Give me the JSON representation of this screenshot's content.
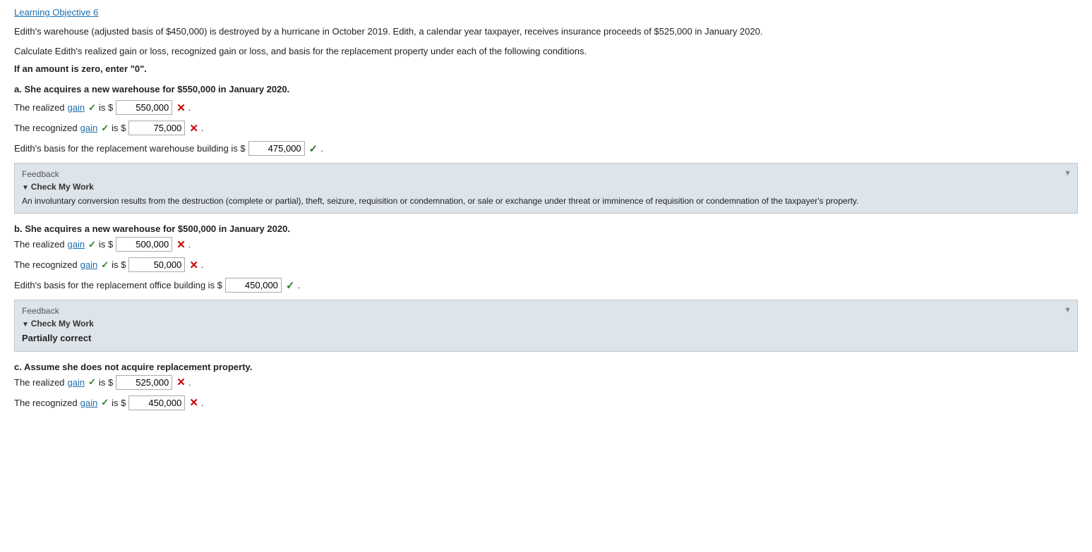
{
  "learningObj": {
    "label": "Learning Objective 6"
  },
  "introText": "Edith's warehouse (adjusted basis of $450,000) is destroyed by a hurricane in October 2019. Edith, a calendar year taxpayer, receives insurance proceeds of $525,000 in January 2020.",
  "calcText": "Calculate Edith's realized gain or loss, recognized gain or loss, and basis for the replacement property under each of the following conditions.",
  "zeroNote": "If an amount is zero, enter \"0\".",
  "sectionA": {
    "label": "a.",
    "description": "She acquires a new warehouse for $550,000 in January 2020.",
    "realizedRow": {
      "prefix": "The realized",
      "gainLabel": "gain",
      "checkmark": "✓",
      "isText": "is $",
      "value": "550,000",
      "xMark": "✕",
      "period": "."
    },
    "recognizedRow": {
      "prefix": "The recognized",
      "gainLabel": "gain",
      "checkmark": "✓",
      "isText": "is $",
      "value": "75,000",
      "xMark": "✕",
      "period": "."
    },
    "basisRow": {
      "prefix": "Edith's basis for the replacement warehouse building is $",
      "value": "475,000",
      "checkmark": "✓",
      "period": "."
    },
    "feedback": {
      "header": "Feedback",
      "checkMyWork": "Check My Work",
      "content": "An involuntary conversion results from the destruction (complete or partial), theft, seizure, requisition or condemnation, or sale or exchange under threat or imminence of requisition or condemnation of the taxpayer's property."
    }
  },
  "sectionB": {
    "label": "b.",
    "description": "She acquires a new warehouse for $500,000 in January 2020.",
    "realizedRow": {
      "prefix": "The realized",
      "gainLabel": "gain",
      "checkmark": "✓",
      "isText": "is $",
      "value": "500,000",
      "xMark": "✕",
      "period": "."
    },
    "recognizedRow": {
      "prefix": "The recognized",
      "gainLabel": "gain",
      "checkmark": "✓",
      "isText": "is $",
      "value": "50,000",
      "xMark": "✕",
      "period": "."
    },
    "basisRow": {
      "prefix": "Edith's basis for the replacement office building is $",
      "value": "450,000",
      "checkmark": "✓",
      "period": "."
    },
    "feedback": {
      "header": "Feedback",
      "checkMyWork": "Check My Work",
      "content": "Partially correct"
    }
  },
  "sectionC": {
    "label": "c.",
    "description": "Assume she does not acquire replacement property.",
    "realizedRow": {
      "prefix": "The realized",
      "gainLabel": "gain",
      "checkmark": "✓",
      "isText": "is $",
      "value": "525,000",
      "xMark": "✕",
      "period": "."
    },
    "recognizedRow": {
      "prefix": "The recognized",
      "gainLabel": "gain",
      "checkmark": "✓",
      "isText": "is $",
      "value": "450,000",
      "xMark": "✕",
      "period": "."
    }
  }
}
